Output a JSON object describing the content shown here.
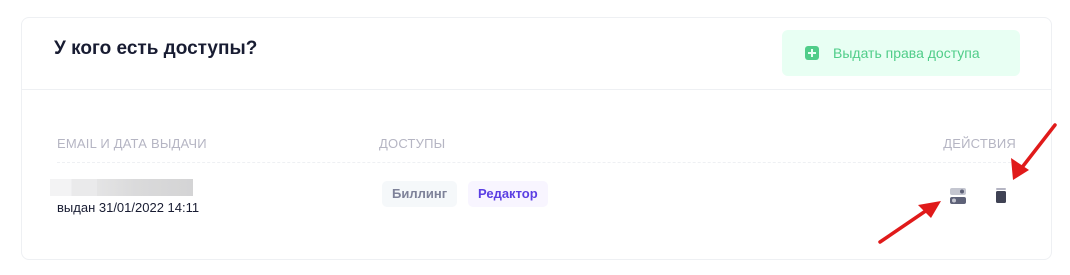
{
  "header": {
    "title": "У кого есть доступы?",
    "grant_button_label": "Выдать права доступа"
  },
  "table": {
    "columns": [
      "EMAIL И ДАТА ВЫДАЧИ",
      "ДОСТУПЫ",
      "ДЕЙСТВИЯ"
    ],
    "rows": [
      {
        "issued": "выдан 31/01/2022 14:11",
        "badges": [
          "Биллинг",
          "Редактор"
        ]
      }
    ]
  },
  "icons": {
    "grant": "plus-square-icon",
    "settings": "toggle-settings-icon",
    "delete": "trash-icon",
    "annotation": "red-arrow"
  },
  "colors": {
    "title": "#181c32",
    "accent_green": "#50cd89",
    "grant_bg": "#e8fff3",
    "muted": "#b5b5c3",
    "badge_purple": "#5b3fe3",
    "annotation_red": "#e01a1a"
  }
}
